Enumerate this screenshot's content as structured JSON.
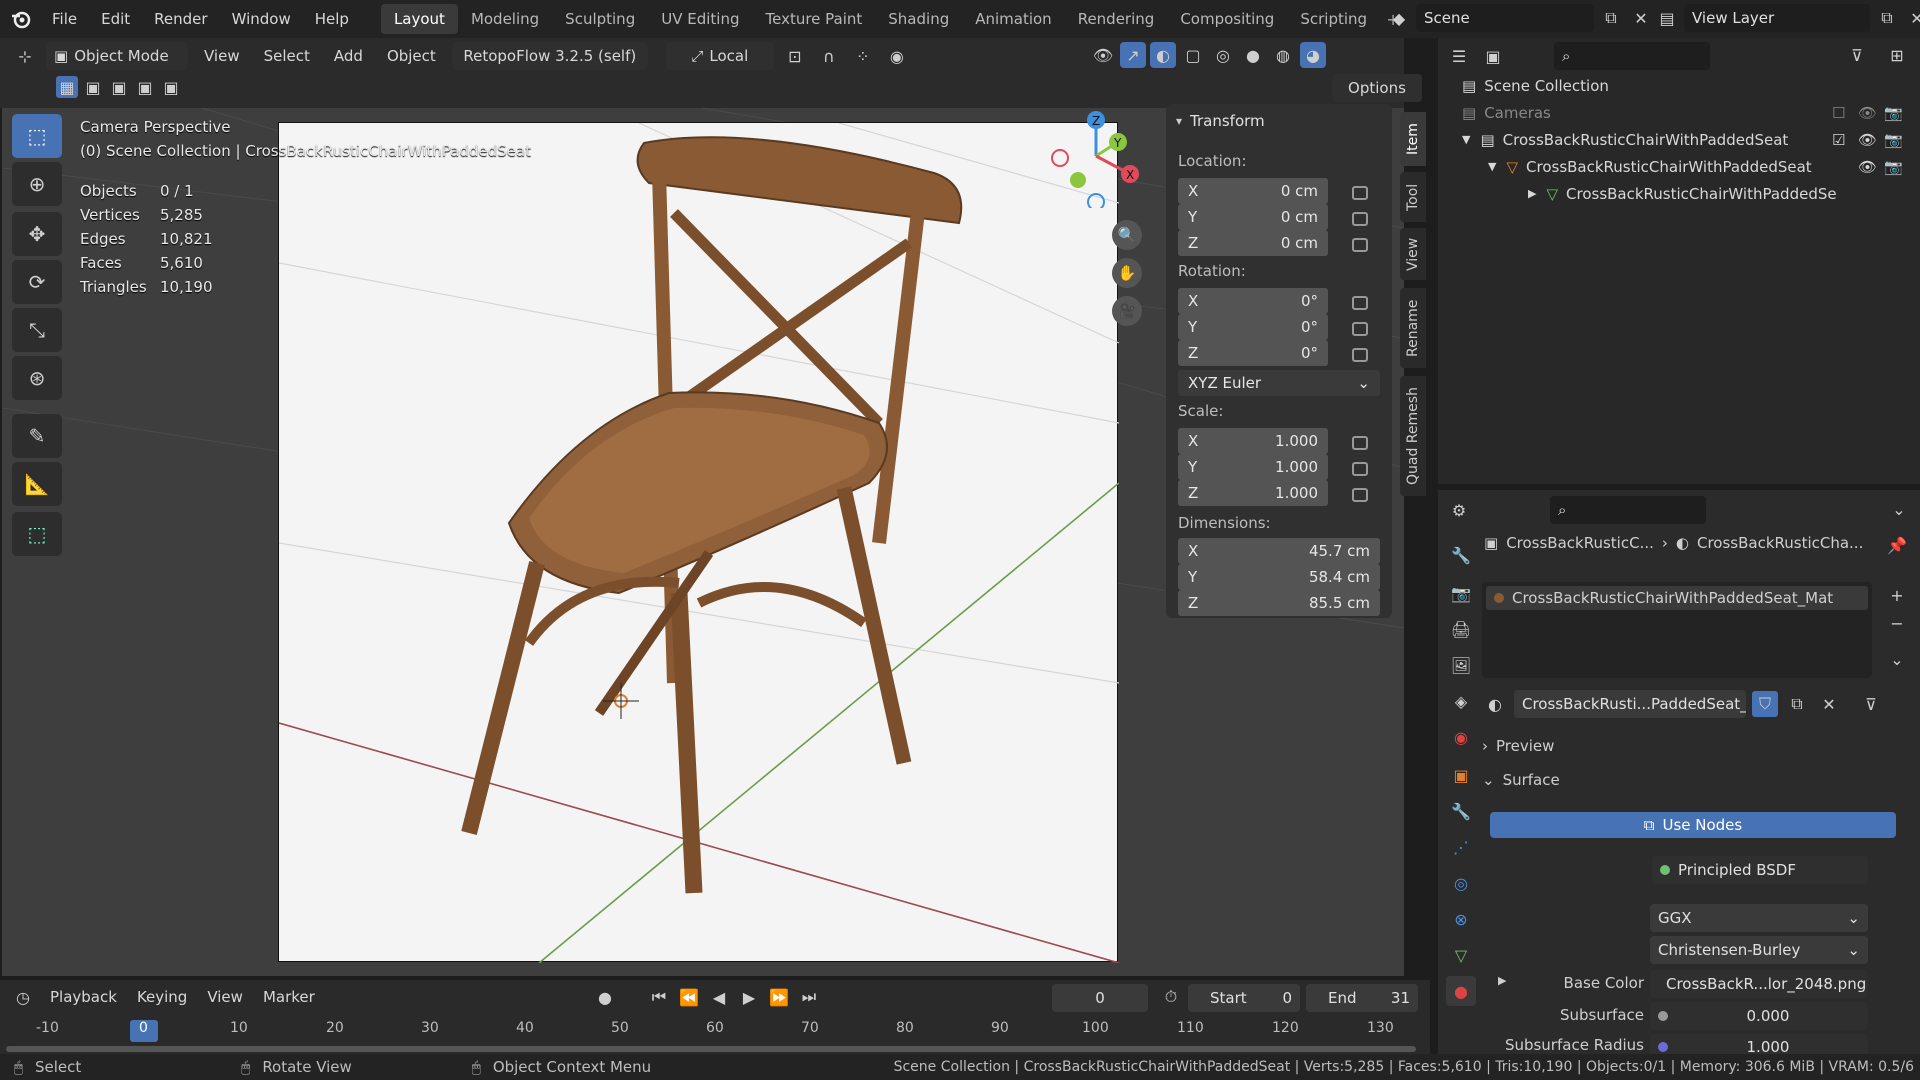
{
  "menu": {
    "items": [
      "File",
      "Edit",
      "Render",
      "Window",
      "Help"
    ]
  },
  "workspaces": {
    "tabs": [
      "Layout",
      "Modeling",
      "Sculpting",
      "UV Editing",
      "Texture Paint",
      "Shading",
      "Animation",
      "Rendering",
      "Compositing",
      "Scripting"
    ],
    "active": "Layout"
  },
  "scene": {
    "name": "Scene",
    "view_layer": "View Layer"
  },
  "header": {
    "mode": "Object Mode",
    "menus": [
      "View",
      "Select",
      "Add",
      "Object"
    ],
    "addon": "RetopoFlow 3.2.5 (self)",
    "orientation": "Local",
    "options": "Options"
  },
  "viewport": {
    "perspective": "Camera Perspective",
    "collection": "(0) Scene Collection | CrossBackRusticChairWithPaddedSeat",
    "stats": [
      {
        "label": "Objects",
        "value": "0 / 1"
      },
      {
        "label": "Vertices",
        "value": "5,285"
      },
      {
        "label": "Edges",
        "value": "10,821"
      },
      {
        "label": "Faces",
        "value": "5,610"
      },
      {
        "label": "Triangles",
        "value": "10,190"
      }
    ]
  },
  "transform": {
    "title": "Transform",
    "location_label": "Location:",
    "location": [
      {
        "axis": "X",
        "value": "0 cm"
      },
      {
        "axis": "Y",
        "value": "0 cm"
      },
      {
        "axis": "Z",
        "value": "0 cm"
      }
    ],
    "rotation_label": "Rotation:",
    "rotation": [
      {
        "axis": "X",
        "value": "0°"
      },
      {
        "axis": "Y",
        "value": "0°"
      },
      {
        "axis": "Z",
        "value": "0°"
      }
    ],
    "rotation_mode": "XYZ Euler",
    "scale_label": "Scale:",
    "scale": [
      {
        "axis": "X",
        "value": "1.000"
      },
      {
        "axis": "Y",
        "value": "1.000"
      },
      {
        "axis": "Z",
        "value": "1.000"
      }
    ],
    "dimensions_label": "Dimensions:",
    "dimensions": [
      {
        "axis": "X",
        "value": "45.7 cm"
      },
      {
        "axis": "Y",
        "value": "58.4 cm"
      },
      {
        "axis": "Z",
        "value": "85.5 cm"
      }
    ]
  },
  "sidetabs": [
    "Item",
    "Tool",
    "View",
    "Rename",
    "Quad Remesh"
  ],
  "outliner": {
    "root": "Scene Collection",
    "rows": [
      "Cameras",
      "CrossBackRusticChairWithPaddedSeat",
      "CrossBackRusticChairWithPaddedSeat",
      "CrossBackRusticChairWithPaddedSe"
    ]
  },
  "properties": {
    "breadcrumb_object": "CrossBackRusticC...",
    "breadcrumb_material": "CrossBackRusticCha...",
    "slot": "CrossBackRusticChairWithPaddedSeat_Mat",
    "material_name": "CrossBackRusti...PaddedSeat_Mat",
    "preview": "Preview",
    "surface_section": "Surface",
    "use_nodes": "Use Nodes",
    "surface_label": "Surface",
    "surface_value": "Principled BSDF",
    "distribution": "GGX",
    "subsurface_method": "Christensen-Burley",
    "base_color_label": "Base Color",
    "base_color_value": "CrossBackR...lor_2048.png",
    "subsurface_label": "Subsurface",
    "subsurface_value": "0.000",
    "subsurface_radius_label": "Subsurface Radius",
    "subsurface_radius_value": "1.000"
  },
  "timeline": {
    "menus": [
      "Playback",
      "Keying",
      "View",
      "Marker"
    ],
    "current_frame": "0",
    "start_label": "Start",
    "start": "0",
    "end_label": "End",
    "end": "31",
    "ruler": [
      "-10",
      "0",
      "10",
      "20",
      "30",
      "40",
      "50",
      "60",
      "70",
      "80",
      "90",
      "100",
      "110",
      "120",
      "130"
    ]
  },
  "status": {
    "select": "Select",
    "rotate": "Rotate View",
    "context": "Object Context Menu",
    "info": "Scene Collection | CrossBackRusticChairWithPaddedSeat | Verts:5,285 | Faces:5,610 | Tris:10,190 | Objects:0/1 | Memory: 306.6 MiB | VRAM: 0.5/6"
  },
  "colors": {
    "accent": "#4772b3",
    "x_axis": "#e04a5a",
    "y_axis": "#8cc63f",
    "z_axis": "#3d8fe0",
    "wood": "#8a5a34"
  }
}
